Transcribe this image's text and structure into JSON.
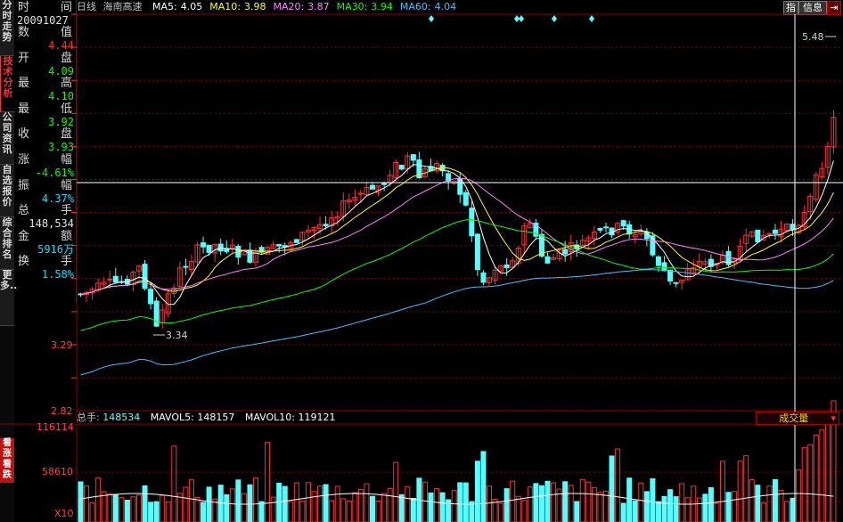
{
  "tabs": {
    "items": [
      {
        "label": "分时走势",
        "active": false
      },
      {
        "label": "技术分析",
        "active": true
      },
      {
        "label": "公司资讯",
        "active": false
      },
      {
        "label": "自选报价",
        "active": false
      },
      {
        "label": "综合排名",
        "active": false
      },
      {
        "label": "更多..",
        "active": false
      }
    ],
    "volume_tab": "看涨看跌"
  },
  "info": {
    "time_label_left": "时",
    "time_label_right": "间",
    "date": "20091027",
    "rows": [
      {
        "l": "数",
        "r": "值",
        "value": "4.44",
        "color": "#ff3030"
      },
      {
        "l": "开",
        "r": "盘",
        "value": "4.09",
        "color": "#00ff00"
      },
      {
        "l": "最",
        "r": "高",
        "value": "4.10",
        "color": "#00ff00"
      },
      {
        "l": "最",
        "r": "低",
        "value": "3.92",
        "color": "#00ff00"
      },
      {
        "l": "收",
        "r": "盘",
        "value": "3.93",
        "color": "#00ff00"
      },
      {
        "l": "涨",
        "r": "幅",
        "value": "-4.61%",
        "color": "#00ff00"
      },
      {
        "l": "振",
        "r": "幅",
        "value": "4.37%",
        "color": "#00e0ff"
      },
      {
        "l": "总",
        "r": "手",
        "value": "148,534",
        "color": "#e0e0e0"
      },
      {
        "l": "金",
        "r": "额",
        "value": "5916万",
        "color": "#00e0ff"
      },
      {
        "l": "换",
        "r": "手",
        "value": "1.58%",
        "color": "#00e0ff"
      }
    ]
  },
  "header": {
    "period": "日线",
    "stock_name": "海南高速",
    "ma": [
      {
        "label": "MA5:",
        "value": "4.05",
        "color": "#ffffff"
      },
      {
        "label": "MA10:",
        "value": "3.98",
        "color": "#ffff00"
      },
      {
        "label": "MA20:",
        "value": "3.87",
        "color": "#ff80ff"
      },
      {
        "label": "MA30:",
        "value": "3.94",
        "color": "#00ff00"
      },
      {
        "label": "MA60:",
        "value": "4.04",
        "color": "#40c0ff"
      }
    ],
    "btn_index": "指",
    "btn_info": "信息"
  },
  "price_axis": {
    "labels": [
      "3.29",
      "2.82"
    ],
    "max_label": "5.48",
    "min_label": "3.34"
  },
  "volume": {
    "total_label": "总手:",
    "total_value": "148534",
    "mavol5_label": "MAVOL5:",
    "mavol5_value": "148157",
    "mavol10_label": "MAVOL10:",
    "mavol10_value": "119121",
    "axis_labels": [
      "116114",
      "58610"
    ],
    "unit": "X10",
    "indicator_button": "成交量"
  },
  "colors": {
    "up": "#ff3030",
    "down": "#54ffff",
    "grid": "#8b0000",
    "crosshair": "#ffffff"
  }
}
